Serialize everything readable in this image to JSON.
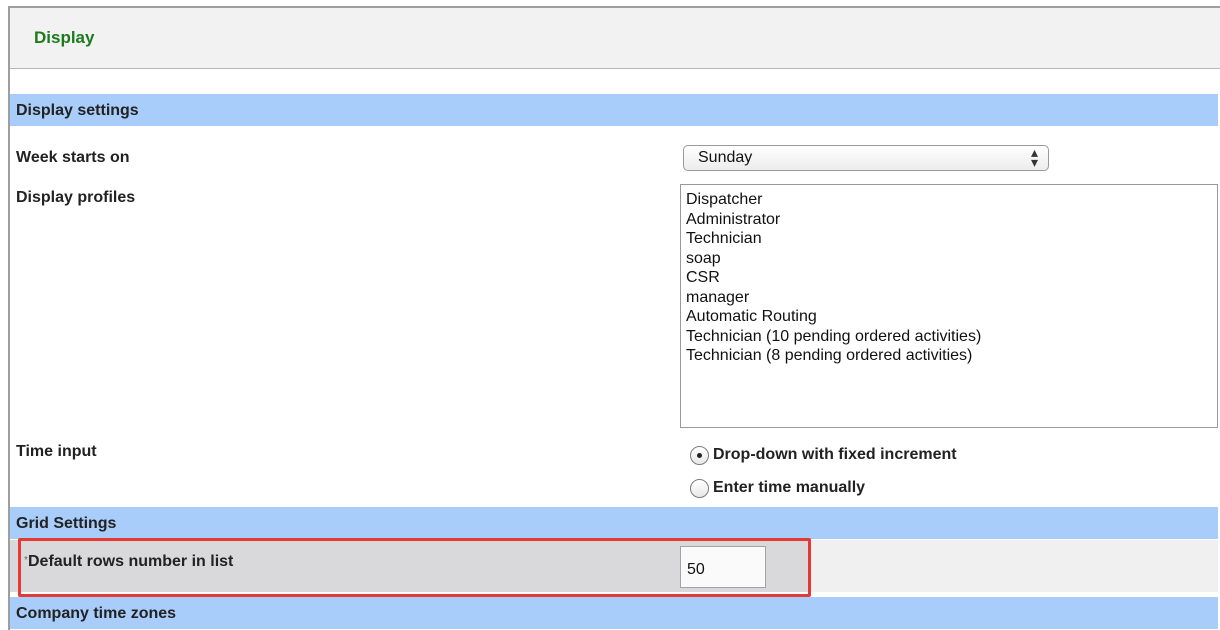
{
  "header": {
    "title": "Display"
  },
  "sections": {
    "display_settings": "Display settings",
    "grid_settings": "Grid Settings",
    "company_time_zones": "Company time zones"
  },
  "week_starts_on": {
    "label": "Week starts on",
    "value": "Sunday"
  },
  "display_profiles": {
    "label": "Display profiles",
    "options": [
      "Dispatcher",
      "Administrator",
      "Technician",
      "soap",
      "CSR",
      "manager",
      "Automatic Routing",
      "Technician (10 pending ordered activities)",
      "Technician (8 pending ordered activities)"
    ]
  },
  "time_input": {
    "label": "Time input",
    "options": [
      {
        "label": "Drop-down with fixed increment",
        "checked": true
      },
      {
        "label": "Enter time manually",
        "checked": false
      }
    ]
  },
  "grid": {
    "required_mark": "*",
    "default_rows_label": "Default rows number in list",
    "default_rows_value": "50"
  },
  "colors": {
    "section_bar": "#a9cdfa",
    "title_green": "#1c7a1c",
    "highlight_red": "#e53935"
  }
}
